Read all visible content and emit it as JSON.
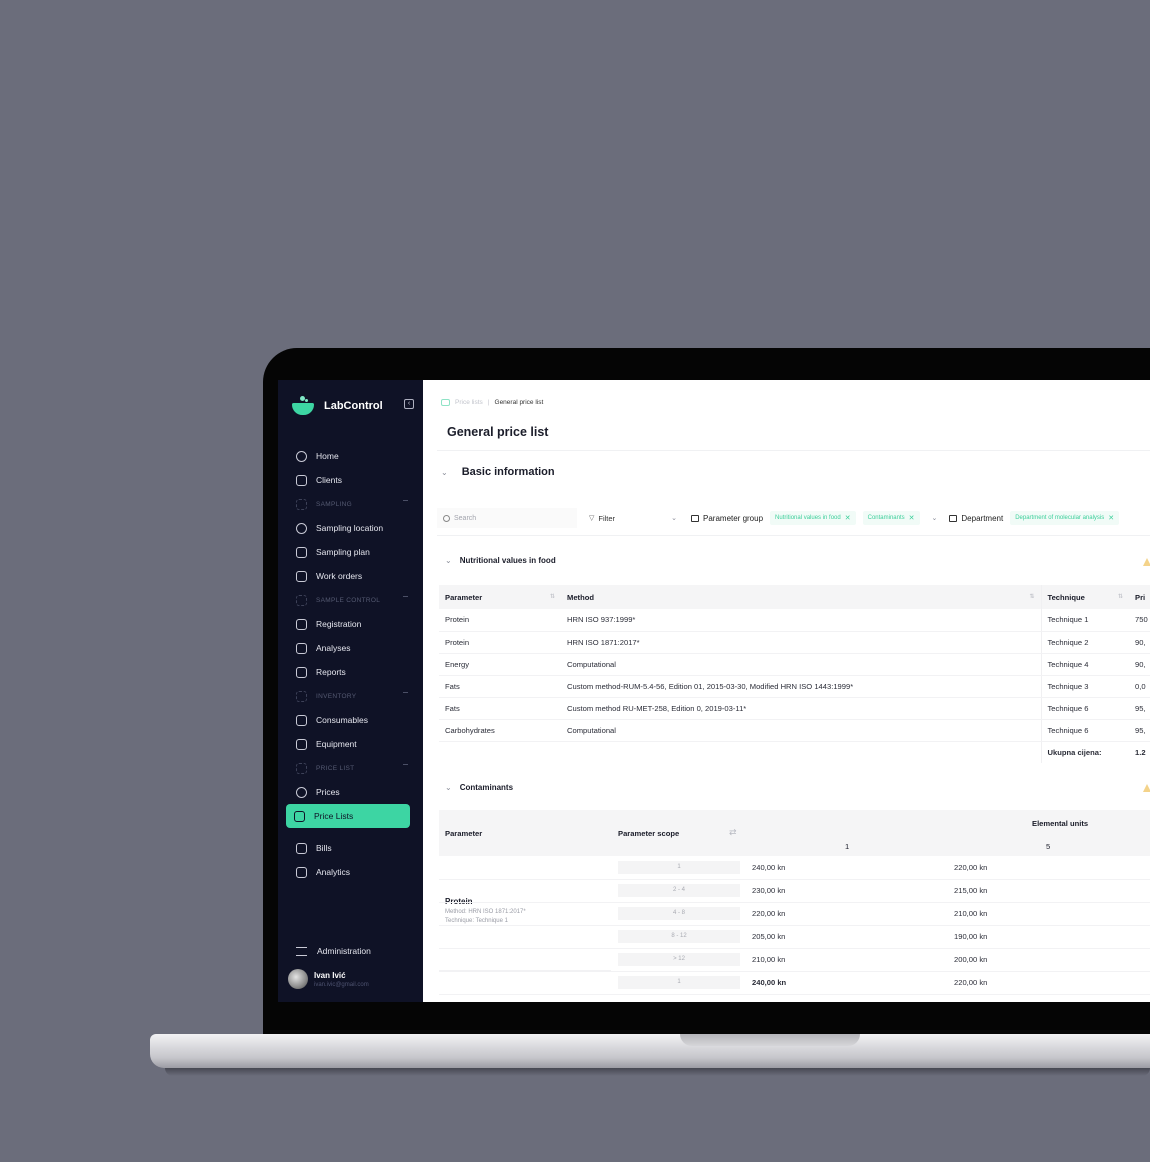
{
  "app": {
    "name": "LabControl"
  },
  "sidebar": {
    "items": [
      {
        "type": "item",
        "label": "Home",
        "icon": "home-icon"
      },
      {
        "type": "item",
        "label": "Clients",
        "icon": "users-icon"
      },
      {
        "type": "section",
        "label": "SAMPLING",
        "icon": "sampling-icon"
      },
      {
        "type": "item",
        "label": "Sampling location",
        "icon": "location-pin-icon"
      },
      {
        "type": "item",
        "label": "Sampling plan",
        "icon": "calendar-icon"
      },
      {
        "type": "item",
        "label": "Work orders",
        "icon": "document-icon"
      },
      {
        "type": "section",
        "label": "SAMPLE CONTROL",
        "icon": "sample-control-icon"
      },
      {
        "type": "item",
        "label": "Registration",
        "icon": "folder-icon"
      },
      {
        "type": "item",
        "label": "Analyses",
        "icon": "cube-icon"
      },
      {
        "type": "item",
        "label": "Reports",
        "icon": "report-icon"
      },
      {
        "type": "section",
        "label": "INVENTORY",
        "icon": "inventory-icon"
      },
      {
        "type": "item",
        "label": "Consumables",
        "icon": "flask-icon"
      },
      {
        "type": "item",
        "label": "Equipment",
        "icon": "equipment-icon"
      },
      {
        "type": "section",
        "label": "PRICE LIST",
        "icon": "price-list-icon"
      },
      {
        "type": "item",
        "label": "Prices",
        "icon": "money-icon"
      },
      {
        "type": "item",
        "label": "Price Lists",
        "icon": "price-lists-icon",
        "active": true
      },
      {
        "type": "gap"
      },
      {
        "type": "item",
        "label": "Bills",
        "icon": "wallet-icon"
      },
      {
        "type": "item",
        "label": "Analytics",
        "icon": "analytics-icon"
      }
    ],
    "administration": "Administration",
    "user": {
      "name": "Ivan Ivić",
      "email": "ivan.ivic@gmail.com"
    }
  },
  "breadcrumb": {
    "parent": "Price lists",
    "separator": "|",
    "current": "General price list"
  },
  "page": {
    "title": "General price list"
  },
  "basic_section": {
    "label": "Basic information"
  },
  "toolbar": {
    "search_placeholder": "Search",
    "filter_label": "Filter",
    "parameter_group_label": "Parameter group",
    "parameter_group_chips": [
      "Nutritional values in food",
      "Contaminants"
    ],
    "department_label": "Department",
    "department_chips": [
      "Department of molecular analysis"
    ]
  },
  "nutritional": {
    "title": "Nutritional values in food",
    "columns": [
      "Parameter",
      "Method",
      "Technique",
      "Pri"
    ],
    "rows": [
      {
        "parameter": "Protein",
        "method": "HRN ISO 937:1999*",
        "technique": "Technique 1",
        "price": "750"
      },
      {
        "parameter": "Protein",
        "method": "HRN ISO 1871:2017*",
        "technique": "Technique 2",
        "price": "90,"
      },
      {
        "parameter": "Energy",
        "method": "Computational",
        "technique": "Technique 4",
        "price": "90,"
      },
      {
        "parameter": "Fats",
        "method": "Custom method-RUM-5.4-56, Edition 01, 2015-03-30, Modified HRN ISO 1443:1999*",
        "technique": "Technique 3",
        "price": "0,0"
      },
      {
        "parameter": "Fats",
        "method": "Custom method RU-MET-258, Edition 0, 2019-03-11*",
        "technique": "Technique 6",
        "price": "95,"
      },
      {
        "parameter": "Carbohydrates",
        "method": "Computational",
        "technique": "Technique 6",
        "price": "95,"
      }
    ],
    "total_label": "Ukupna cijena:",
    "total_value": "1.2"
  },
  "contaminants": {
    "title": "Contaminants",
    "columns": {
      "parameter": "Parameter",
      "scope": "Parameter scope",
      "units_group": "Elemental units",
      "unit_1": "1",
      "unit_5": "5"
    },
    "protein": {
      "name": "Protein",
      "method": "Method: HRN ISO 1871:2017*",
      "technique": "Technique: Technique 1"
    },
    "rows": [
      {
        "scope": "1",
        "u1": "240,00 kn",
        "u5": "220,00 kn"
      },
      {
        "scope": "2 - 4",
        "u1": "230,00 kn",
        "u5": "215,00 kn"
      },
      {
        "scope": "4 - 8",
        "u1": "220,00 kn",
        "u5": "210,00 kn"
      },
      {
        "scope": "8 - 12",
        "u1": "205,00 kn",
        "u5": "190,00 kn"
      },
      {
        "scope": "> 12",
        "u1": "210,00 kn",
        "u5": "200,00 kn"
      },
      {
        "scope": "1",
        "u1": "240,00 kn",
        "u5": "220,00 kn",
        "bold": true
      }
    ]
  },
  "colors": {
    "accent": "#3dd5a3",
    "sidebar_bg": "#0f1226",
    "background": "#6b6d7b"
  }
}
